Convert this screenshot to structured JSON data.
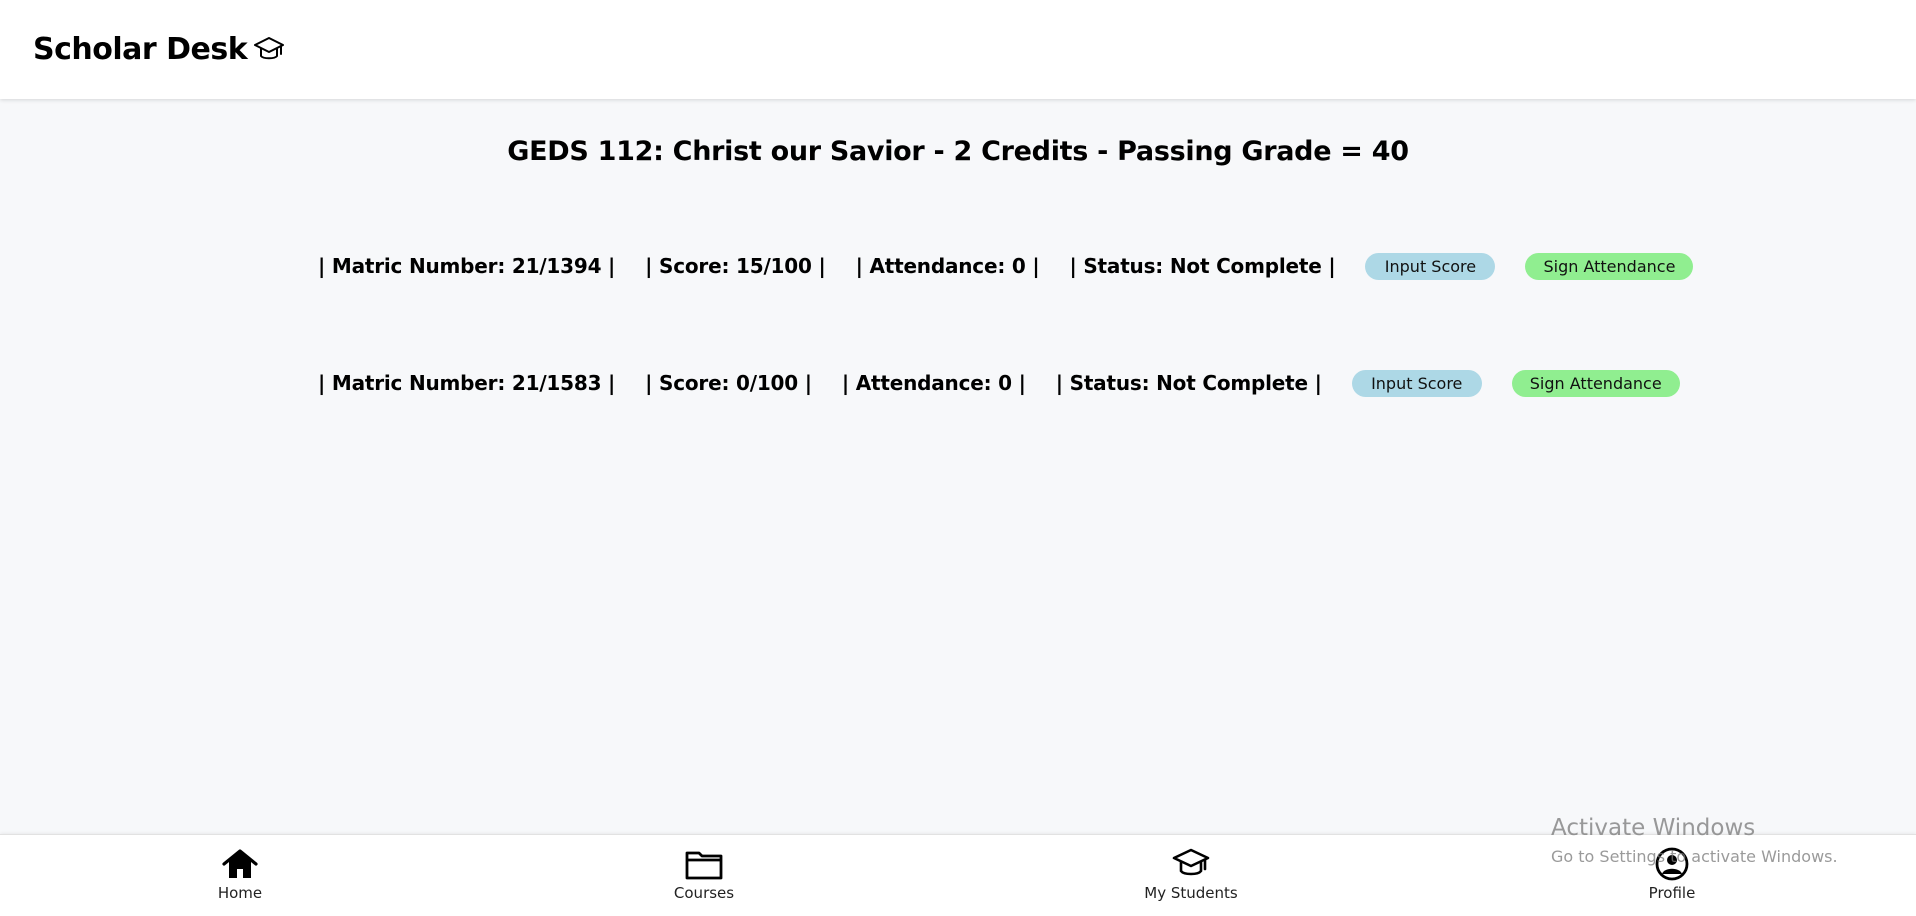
{
  "header": {
    "title": "Scholar Desk",
    "icon": "graduation-cap-icon"
  },
  "course": {
    "title": "GEDS 112: Christ our Savior - 2 Credits - Passing Grade = 40"
  },
  "students": [
    {
      "matric": "| Matric Number: 21/1394 |",
      "score": "| Score: 15/100 |",
      "attendance": "| Attendance: 0 |",
      "status": "| Status: Not Complete |",
      "input_score_label": "Input Score",
      "sign_attendance_label": "Sign Attendance"
    },
    {
      "matric": "| Matric Number: 21/1583 |",
      "score": "| Score: 0/100 |",
      "attendance": "| Attendance: 0 |",
      "status": "| Status: Not Complete |",
      "input_score_label": "Input Score",
      "sign_attendance_label": "Sign Attendance"
    }
  ],
  "colors": {
    "input_score_button": "#add8e6",
    "sign_attendance_button": "#90ee90",
    "background": "#f7f8fa"
  },
  "nav": {
    "items": [
      {
        "label": "Home",
        "icon": "home-icon"
      },
      {
        "label": "Courses",
        "icon": "folder-icon"
      },
      {
        "label": "My Students",
        "icon": "graduation-cap-icon"
      },
      {
        "label": "Profile",
        "icon": "user-circle-icon"
      }
    ]
  },
  "watermark": {
    "title": "Activate Windows",
    "subtitle": "Go to Settings to activate Windows."
  }
}
